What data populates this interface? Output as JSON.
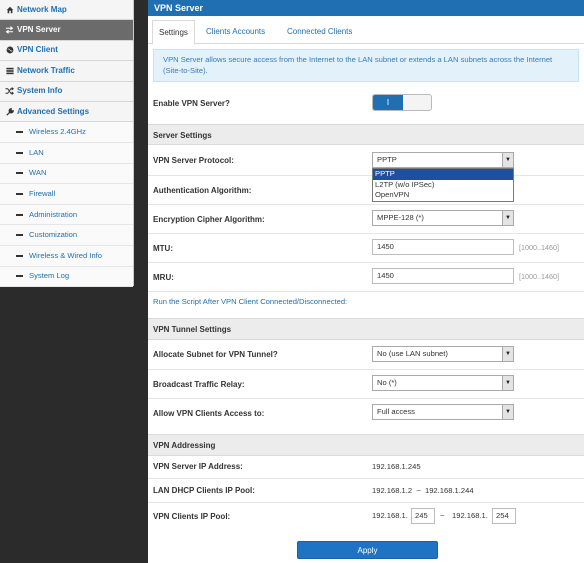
{
  "sidebar": {
    "items": [
      {
        "label": "Network Map",
        "icon": "home-icon"
      },
      {
        "label": "VPN Server",
        "icon": "exchange-icon",
        "active": true
      },
      {
        "label": "VPN Client",
        "icon": "globe-icon"
      },
      {
        "label": "Network Traffic",
        "icon": "list-icon"
      },
      {
        "label": "System Info",
        "icon": "shuffle-icon"
      },
      {
        "label": "Advanced Settings",
        "icon": "wrench-icon"
      }
    ],
    "subitems": [
      "Wireless 2.4GHz",
      "LAN",
      "WAN",
      "Firewall",
      "Administration",
      "Customization",
      "Wireless & Wired Info",
      "System Log"
    ]
  },
  "main": {
    "title": "VPN Server",
    "tabs": [
      "Settings",
      "Clients Accounts",
      "Connected Clients"
    ],
    "info": "VPN Server allows secure access from the Internet to the LAN subnet or extends a LAN subnets across the Internet (Site-to-Site).",
    "enable_label": "Enable VPN Server?",
    "enable_state": "I",
    "sections": {
      "server": "Server Settings",
      "tunnel": "VPN Tunnel Settings",
      "addressing": "VPN Addressing"
    },
    "fields": {
      "protocol_label": "VPN Server Protocol:",
      "protocol_value": "PPTP",
      "protocol_options": [
        "PPTP",
        "L2TP (w/o IPSec)",
        "OpenVPN"
      ],
      "auth_label": "Authentication Algorithm:",
      "cipher_label": "Encryption Cipher Algorithm:",
      "cipher_value": "MPPE-128 (*)",
      "mtu_label": "MTU:",
      "mtu_value": "1450",
      "mtu_hint": "[1000..1460]",
      "mru_label": "MRU:",
      "mru_value": "1450",
      "mru_hint": "[1000..1460]",
      "script_link": "Run the Script After VPN Client Connected/Disconnected:",
      "subnet_label": "Allocate Subnet for VPN Tunnel?",
      "subnet_value": "No (use LAN subnet)",
      "broadcast_label": "Broadcast Traffic Relay:",
      "broadcast_value": "No (*)",
      "access_label": "Allow VPN Clients Access to:",
      "access_value": "Full access",
      "server_ip_label": "VPN Server IP Address:",
      "server_ip_value": "192.168.1.245",
      "dhcp_pool_label": "LAN DHCP Clients IP Pool:",
      "dhcp_pool_value": "192.168.1.2  ~  192.168.1.244",
      "clients_pool_label": "VPN Clients IP Pool:",
      "clients_pool_prefix1": "192.168.1.",
      "clients_pool_start": "245",
      "clients_pool_sep": "~",
      "clients_pool_prefix2": "192.168.1.",
      "clients_pool_end": "254"
    },
    "apply_label": "Apply"
  },
  "colors": {
    "accent": "#1f6fb2",
    "sidebar_active": "#6b6b6b",
    "background": "#2b2b2b"
  }
}
